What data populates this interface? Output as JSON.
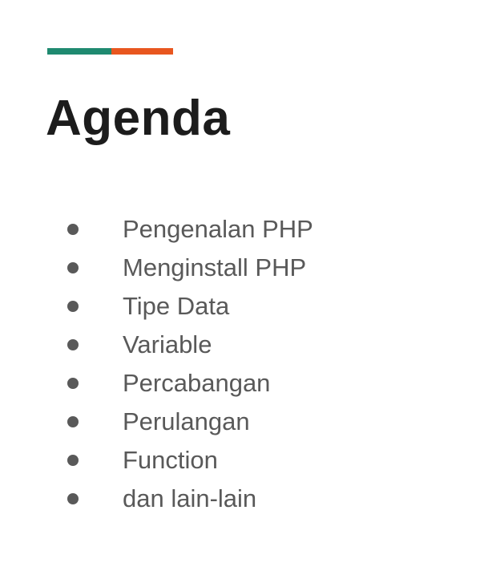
{
  "slide": {
    "title": "Agenda",
    "accent_colors": {
      "teal": "#1f8a70",
      "orange": "#e8561f"
    },
    "items": [
      {
        "label": "Pengenalan PHP"
      },
      {
        "label": "Menginstall PHP"
      },
      {
        "label": "Tipe Data"
      },
      {
        "label": "Variable"
      },
      {
        "label": "Percabangan"
      },
      {
        "label": "Perulangan"
      },
      {
        "label": "Function"
      },
      {
        "label": "dan lain-lain"
      }
    ]
  }
}
